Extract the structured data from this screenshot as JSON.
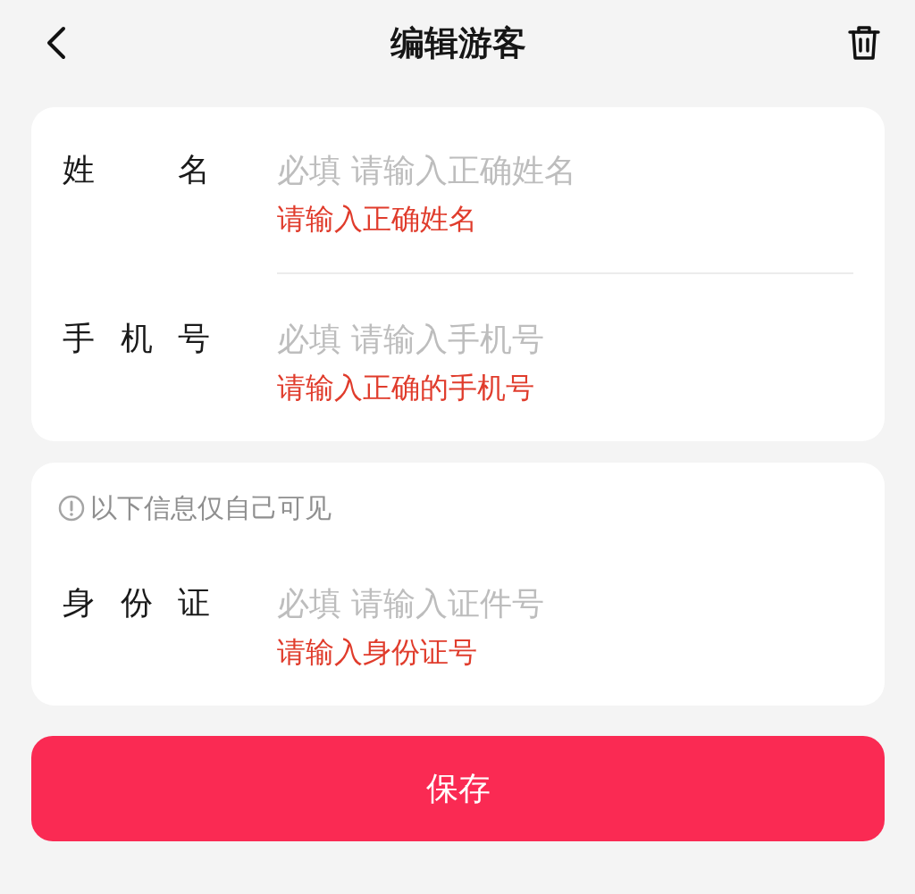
{
  "header": {
    "title": "编辑游客"
  },
  "cards": [
    {
      "fields": [
        {
          "label": "姓名",
          "placeholder": "必填 请输入正确姓名",
          "error": "请输入正确姓名"
        },
        {
          "label": "手机号",
          "placeholder": "必填 请输入手机号",
          "error": "请输入正确的手机号"
        }
      ]
    },
    {
      "notice": "以下信息仅自己可见",
      "fields": [
        {
          "label": "身份证",
          "placeholder": "必填 请输入证件号",
          "error": "请输入身份证号"
        }
      ]
    }
  ],
  "save_button": "保存"
}
